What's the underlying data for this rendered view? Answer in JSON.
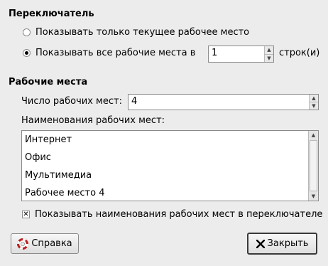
{
  "switcher": {
    "heading": "Переключатель",
    "option_current": "Показывать только текущее рабочее место",
    "option_all": "Показывать все рабочие места в",
    "rows_value": "1",
    "rows_suffix": "строк(и)"
  },
  "workspaces": {
    "heading": "Рабочие места",
    "count_label": "Число рабочих мест:",
    "count_value": "4",
    "names_label": "Наименования рабочих мест:",
    "names": [
      "Интернет",
      "Офис",
      "Мультимедиа",
      "Рабочее место 4"
    ],
    "show_names_label": "Показывать наименования рабочих мест в переключателе"
  },
  "buttons": {
    "help": "Справка",
    "close": "Закрыть"
  },
  "icons": {
    "help": "lifebuoy-icon",
    "close": "x-icon"
  }
}
